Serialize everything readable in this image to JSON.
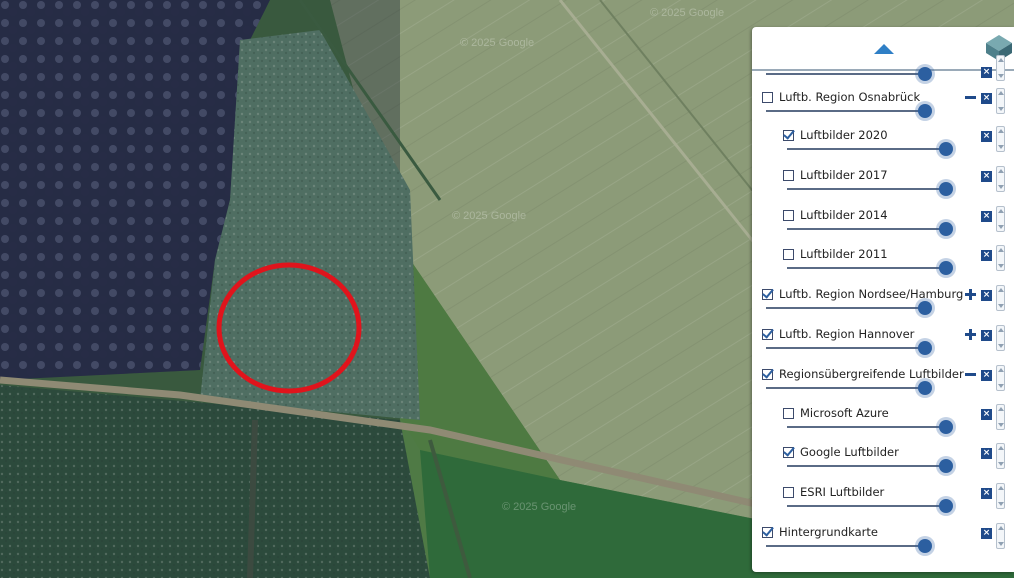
{
  "map": {
    "watermark": "© 2025 Google",
    "highlight_color": "#e0141c"
  },
  "panel": {
    "accent": "#2c5fa0",
    "layers": [
      {
        "label": "Luftb. Region Osnabrück",
        "checked": false,
        "level": 0,
        "controls": "minus",
        "opacity": 1.0
      },
      {
        "label": "Luftbilder 2020",
        "checked": true,
        "level": 1,
        "controls": "none",
        "opacity": 1.0
      },
      {
        "label": "Luftbilder 2017",
        "checked": false,
        "level": 1,
        "controls": "none",
        "opacity": 1.0
      },
      {
        "label": "Luftbilder 2014",
        "checked": false,
        "level": 1,
        "controls": "none",
        "opacity": 1.0
      },
      {
        "label": "Luftbilder 2011",
        "checked": false,
        "level": 1,
        "controls": "none",
        "opacity": 1.0
      },
      {
        "label": "Luftb. Region Nordsee/Hamburg",
        "checked": true,
        "level": 0,
        "controls": "plus",
        "opacity": 1.0
      },
      {
        "label": "Luftb. Region Hannover",
        "checked": true,
        "level": 0,
        "controls": "plus",
        "opacity": 1.0
      },
      {
        "label": "Regionsübergreifende Luftbilder",
        "checked": true,
        "level": 0,
        "controls": "minus",
        "opacity": 1.0
      },
      {
        "label": "Microsoft Azure",
        "checked": false,
        "level": 1,
        "controls": "none",
        "opacity": 1.0
      },
      {
        "label": "Google Luftbilder",
        "checked": true,
        "level": 1,
        "controls": "none",
        "opacity": 1.0
      },
      {
        "label": "ESRI Luftbilder",
        "checked": false,
        "level": 1,
        "controls": "none",
        "opacity": 1.0
      },
      {
        "label": "Hintergrundkarte",
        "checked": true,
        "level": 0,
        "controls": "none",
        "opacity": 1.0
      }
    ],
    "remove_symbol": "×"
  }
}
